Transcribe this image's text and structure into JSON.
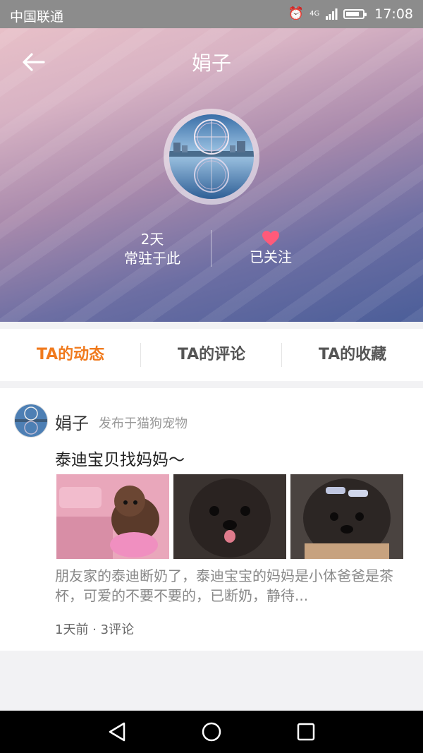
{
  "status_bar": {
    "carrier": "中国联通",
    "time": "17:08",
    "network": "4G",
    "icons": [
      "alarm-icon",
      "signal-icon",
      "battery-icon"
    ]
  },
  "header": {
    "title": "娟子",
    "back_icon": "arrow-left-icon",
    "stats": [
      {
        "value": "2天",
        "label": "常驻于此"
      },
      {
        "icon": "heart-icon",
        "label": "已关注"
      }
    ]
  },
  "tabs": [
    {
      "label": "TA的动态",
      "active": true
    },
    {
      "label": "TA的评论",
      "active": false
    },
    {
      "label": "TA的收藏",
      "active": false
    }
  ],
  "post": {
    "author": "娟子",
    "meta": "发布于猫狗宠物",
    "title": "泰迪宝贝找妈妈～",
    "excerpt": "朋友家的泰迪断奶了，泰迪宝宝的妈妈是小体爸爸是茶杯，可爱的不要不要的，已断奶，静待...",
    "footer": "1天前 · 3评论"
  },
  "colors": {
    "accent": "#f07a1d",
    "heart": "#ff5a7a"
  },
  "nav": [
    "back-triangle-icon",
    "home-circle-icon",
    "recents-square-icon"
  ]
}
